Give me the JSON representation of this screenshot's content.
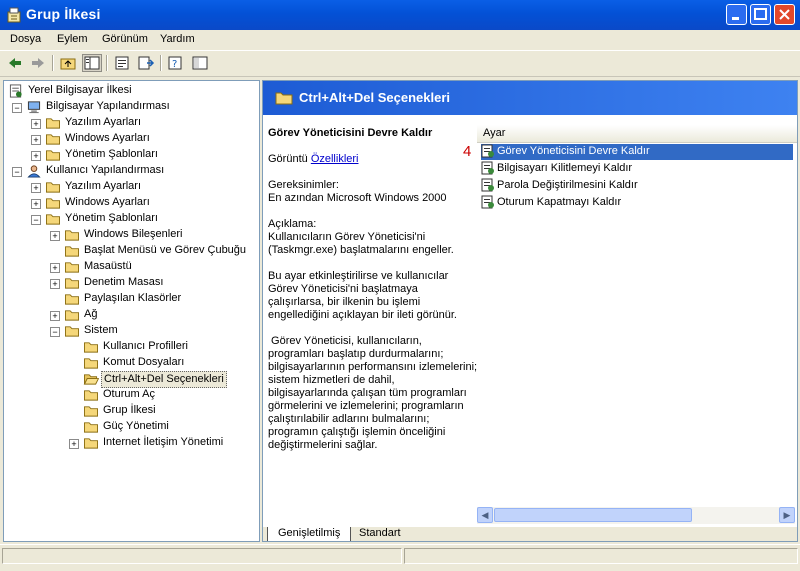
{
  "window": {
    "title": "Grup İlkesi"
  },
  "menu": [
    "Dosya",
    "Eylem",
    "Görünüm",
    "Yardım"
  ],
  "toolbar": {
    "icons": [
      "back-arrow-icon",
      "forward-arrow-icon",
      "up-folder-icon",
      "show-tree-icon",
      "properties-icon",
      "export-list-icon",
      "help-icon",
      "console-tree-icon"
    ]
  },
  "tree": [
    {
      "label": "Yerel Bilgisayar İlkesi",
      "level": 0,
      "exp": "",
      "icon": "policy"
    },
    {
      "label": "Bilgisayar Yapılandırması",
      "level": 1,
      "exp": "−",
      "icon": "computer"
    },
    {
      "label": "Yazılım Ayarları",
      "level": 2,
      "exp": "+",
      "icon": "folder"
    },
    {
      "label": "Windows Ayarları",
      "level": 2,
      "exp": "+",
      "icon": "folder"
    },
    {
      "label": "Yönetim Şablonları",
      "level": 2,
      "exp": "+",
      "icon": "folder"
    },
    {
      "label": "Kullanıcı Yapılandırması",
      "level": 1,
      "exp": "−",
      "icon": "user"
    },
    {
      "label": "Yazılım Ayarları",
      "level": 2,
      "exp": "+",
      "icon": "folder"
    },
    {
      "label": "Windows Ayarları",
      "level": 2,
      "exp": "+",
      "icon": "folder"
    },
    {
      "label": "Yönetim Şablonları",
      "level": 2,
      "exp": "−",
      "icon": "folder"
    },
    {
      "label": "Windows Bileşenleri",
      "level": 3,
      "exp": "+",
      "icon": "folder"
    },
    {
      "label": "Başlat Menüsü ve Görev Çubuğu",
      "level": 3,
      "exp": "",
      "icon": "folder"
    },
    {
      "label": "Masaüstü",
      "level": 3,
      "exp": "+",
      "icon": "folder"
    },
    {
      "label": "Denetim Masası",
      "level": 3,
      "exp": "+",
      "icon": "folder"
    },
    {
      "label": "Paylaşılan Klasörler",
      "level": 3,
      "exp": "",
      "icon": "folder"
    },
    {
      "label": "Ağ",
      "level": 3,
      "exp": "+",
      "icon": "folder"
    },
    {
      "label": "Sistem",
      "level": 3,
      "exp": "−",
      "icon": "folder"
    },
    {
      "label": "Kullanıcı Profilleri",
      "level": 4,
      "exp": "",
      "icon": "folder"
    },
    {
      "label": "Komut Dosyaları",
      "level": 4,
      "exp": "",
      "icon": "folder"
    },
    {
      "label": "Ctrl+Alt+Del Seçenekleri",
      "level": 4,
      "exp": "",
      "icon": "folder-open",
      "selected": true
    },
    {
      "label": "Oturum Aç",
      "level": 4,
      "exp": "",
      "icon": "folder"
    },
    {
      "label": "Grup İlkesi",
      "level": 4,
      "exp": "",
      "icon": "folder"
    },
    {
      "label": "Güç Yönetimi",
      "level": 4,
      "exp": "",
      "icon": "folder"
    },
    {
      "label": "Internet İletişim Yönetimi",
      "level": 4,
      "exp": "+",
      "icon": "folder"
    }
  ],
  "details": {
    "header": "Ctrl+Alt+Del Seçenekleri",
    "setting_title": "Görev Yöneticisini Devre Kaldır",
    "display_label": "Görüntü",
    "properties_link": "Özellikleri",
    "requirements_label": "Gereksinimler:",
    "requirements_value": "En azından Microsoft Windows 2000",
    "description_label": "Açıklama:",
    "description_lines": [
      "Kullanıcıların Görev Yöneticisi'ni",
      "(Taskmgr.exe) başlatmalarını engeller."
    ],
    "para2_lines": [
      "Bu ayar etkinleştirilirse ve kullanıcılar",
      "Görev Yöneticisi'ni başlatmaya",
      "çalışırlarsa, bir ilkenin bu işlemi",
      "engellediğini açıklayan bir ileti görünür."
    ],
    "para3_lines": [
      " Görev Yöneticisi, kullanıcıların,",
      "programları başlatıp durdurmalarını;",
      "bilgisayarlarının performansını izlemelerini;",
      "sistem hizmetleri de dahil,",
      "bilgisayarlarında çalışan tüm programları",
      "görmelerini ve izlemelerini; programların",
      "çalıştırılabilir adlarını bulmalarını;",
      "programın çalıştığı işlemin önceliğini",
      "değiştirmelerini sağlar."
    ]
  },
  "list": {
    "column": "Ayar",
    "marker": "4",
    "items": [
      {
        "label": "Görev Yöneticisini Devre Kaldır",
        "selected": true
      },
      {
        "label": "Bilgisayarı Kilitlemeyi Kaldır",
        "selected": false
      },
      {
        "label": "Parola Değiştirilmesini Kaldır",
        "selected": false
      },
      {
        "label": "Oturum Kapatmayı Kaldır",
        "selected": false
      }
    ]
  },
  "tabs": [
    {
      "label": "Genişletilmiş",
      "active": true
    },
    {
      "label": "Standart",
      "active": false
    }
  ],
  "colors": {
    "title_bar": "#0351d6",
    "selection": "#316ac5",
    "header_band": "#1d5bd4",
    "marker": "#cc0000"
  }
}
